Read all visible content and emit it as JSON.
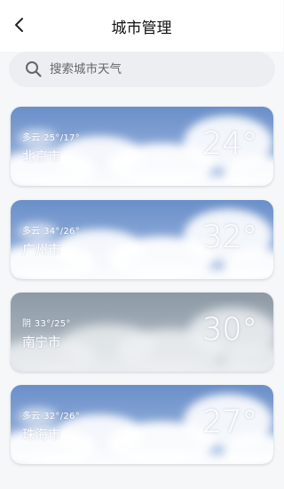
{
  "header": {
    "title": "城市管理"
  },
  "search": {
    "placeholder": "搜索城市天气"
  },
  "cards": [
    {
      "condition_range": "多云 25°/17°",
      "city": "北京市",
      "temp": "24°",
      "sky": "cloudy"
    },
    {
      "condition_range": "多云 34°/26°",
      "city": "广州市",
      "temp": "32°",
      "sky": "cloudy"
    },
    {
      "condition_range": "阴 33°/25°",
      "city": "南宁市",
      "temp": "30°",
      "sky": "overcast"
    },
    {
      "condition_range": "多云 32°/26°",
      "city": "珠海市",
      "temp": "27°",
      "sky": "cloudy"
    }
  ],
  "colors": {
    "cloudy_sky_top": "#6a8fc9",
    "cloudy_sky_bottom": "#9db7df",
    "overcast_sky_top": "#8d9aa6",
    "overcast_sky_bottom": "#b3bcc4",
    "page_bg": "#f6f7f9",
    "search_bg": "#eceef1"
  },
  "icons": {
    "back": "back-arrow-icon",
    "search": "search-icon"
  }
}
